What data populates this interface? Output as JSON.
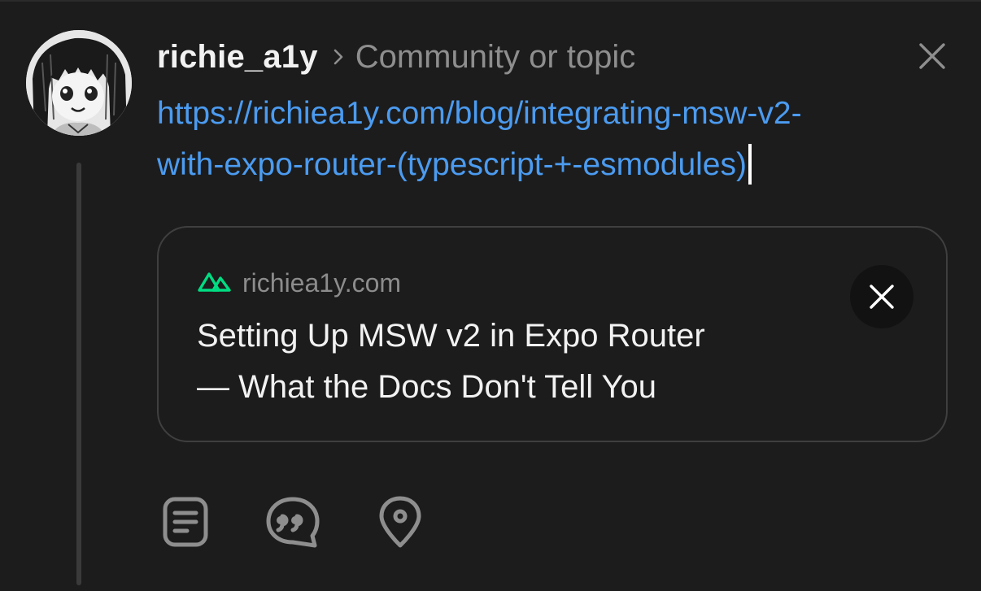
{
  "header": {
    "username": "richie_a1y",
    "community_placeholder": "Community or topic"
  },
  "compose": {
    "text_line1": "https://richiea1y.com/blog/integrating-msw-v2-",
    "text_line2": "with-expo-router-(typescript-+-esmodules)"
  },
  "link_preview": {
    "domain": "richiea1y.com",
    "title_line1": "Setting Up MSW v2 in Expo Router",
    "title_line2": "— What the Docs Don't Tell You",
    "site_icon": "nuxt-logo-icon"
  },
  "toolbar": {
    "items": [
      {
        "icon": "document-icon"
      },
      {
        "icon": "quote-icon"
      },
      {
        "icon": "location-pin-icon"
      }
    ]
  },
  "colors": {
    "background": "#1c1c1c",
    "link": "#4b9bf0",
    "muted": "#8e8e8e",
    "card_border": "#3f3f3f",
    "brand_green": "#00dc82"
  }
}
